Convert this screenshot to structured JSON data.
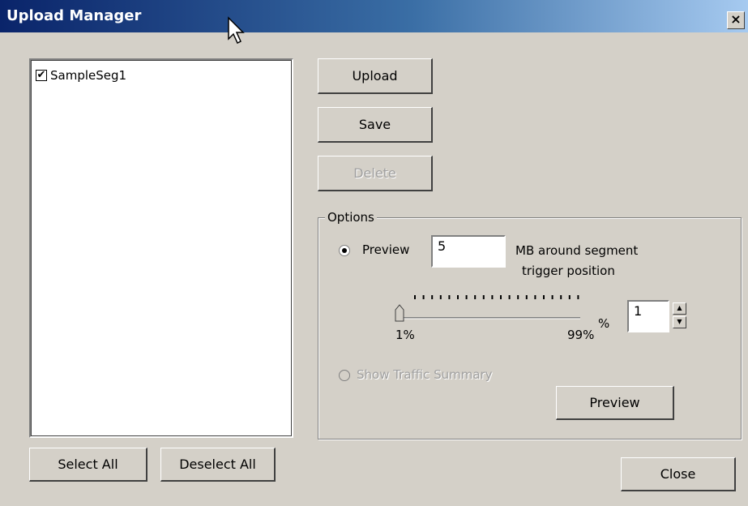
{
  "window": {
    "title": "Upload Manager",
    "close_glyph": "×"
  },
  "list": {
    "items": [
      {
        "label": "SampleSeg1",
        "checked": true
      }
    ]
  },
  "buttons": {
    "upload": "Upload",
    "save": "Save",
    "delete": "Delete",
    "select_all": "Select All",
    "deselect_all": "Deselect All",
    "preview": "Preview",
    "close": "Close"
  },
  "options": {
    "group_label": "Options",
    "preview_radio_label": "Preview",
    "preview_selected": true,
    "mb_value": "5",
    "mb_text_line1": "MB around segment",
    "mb_text_line2": "trigger position",
    "slider": {
      "min_label": "1%",
      "max_label": "99%",
      "value_percent": 1
    },
    "percent_sign": "%",
    "spin_value": "1",
    "traffic_summary_label": "Show Traffic Summary",
    "traffic_summary_enabled": false
  },
  "icons": {
    "cursor": "arrow-cursor-icon",
    "close": "close-icon",
    "up": "spin-up-icon",
    "down": "spin-down-icon"
  }
}
